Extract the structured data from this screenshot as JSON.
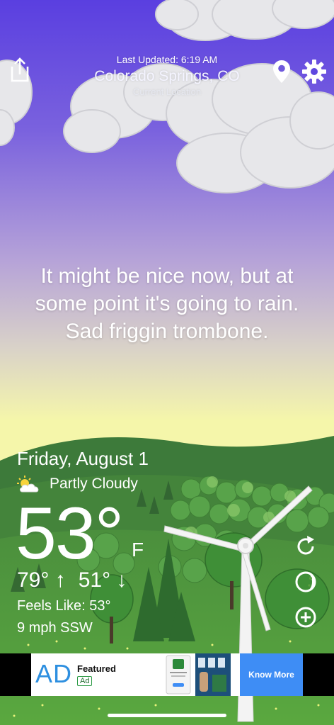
{
  "header": {
    "last_updated": "Last Updated: 6:19 AM",
    "city": "Colorado Springs, CO",
    "location_label": "Current Location"
  },
  "toolbar": {
    "share_icon": "share-icon",
    "location_icon": "location-pin-icon",
    "settings_icon": "gear-icon"
  },
  "message": "It might be nice now, but at some point it's going to rain. Sad friggin trombone.",
  "weather": {
    "date": "Friday, August 1",
    "condition": "Partly Cloudy",
    "condition_icon": "partly-cloudy-icon",
    "temperature": "53°",
    "unit": "F",
    "high": "79° ↑",
    "low": "51° ↓",
    "feels_like": "Feels Like: 53°",
    "wind": "9 mph SSW"
  },
  "actions": {
    "refresh_icon": "refresh-icon",
    "moon_icon": "moon-phase-icon",
    "add_icon": "add-location-icon"
  },
  "ad": {
    "logo": "AD",
    "title": "Featured",
    "tag": "Ad",
    "cta": "Know More"
  },
  "colors": {
    "sky_top": "#5a3fe0",
    "sky_mid": "#b8a6d6",
    "sky_bottom": "#f6f7a8",
    "hills": "#3f8a3a",
    "ad_button": "#3e8df5"
  }
}
